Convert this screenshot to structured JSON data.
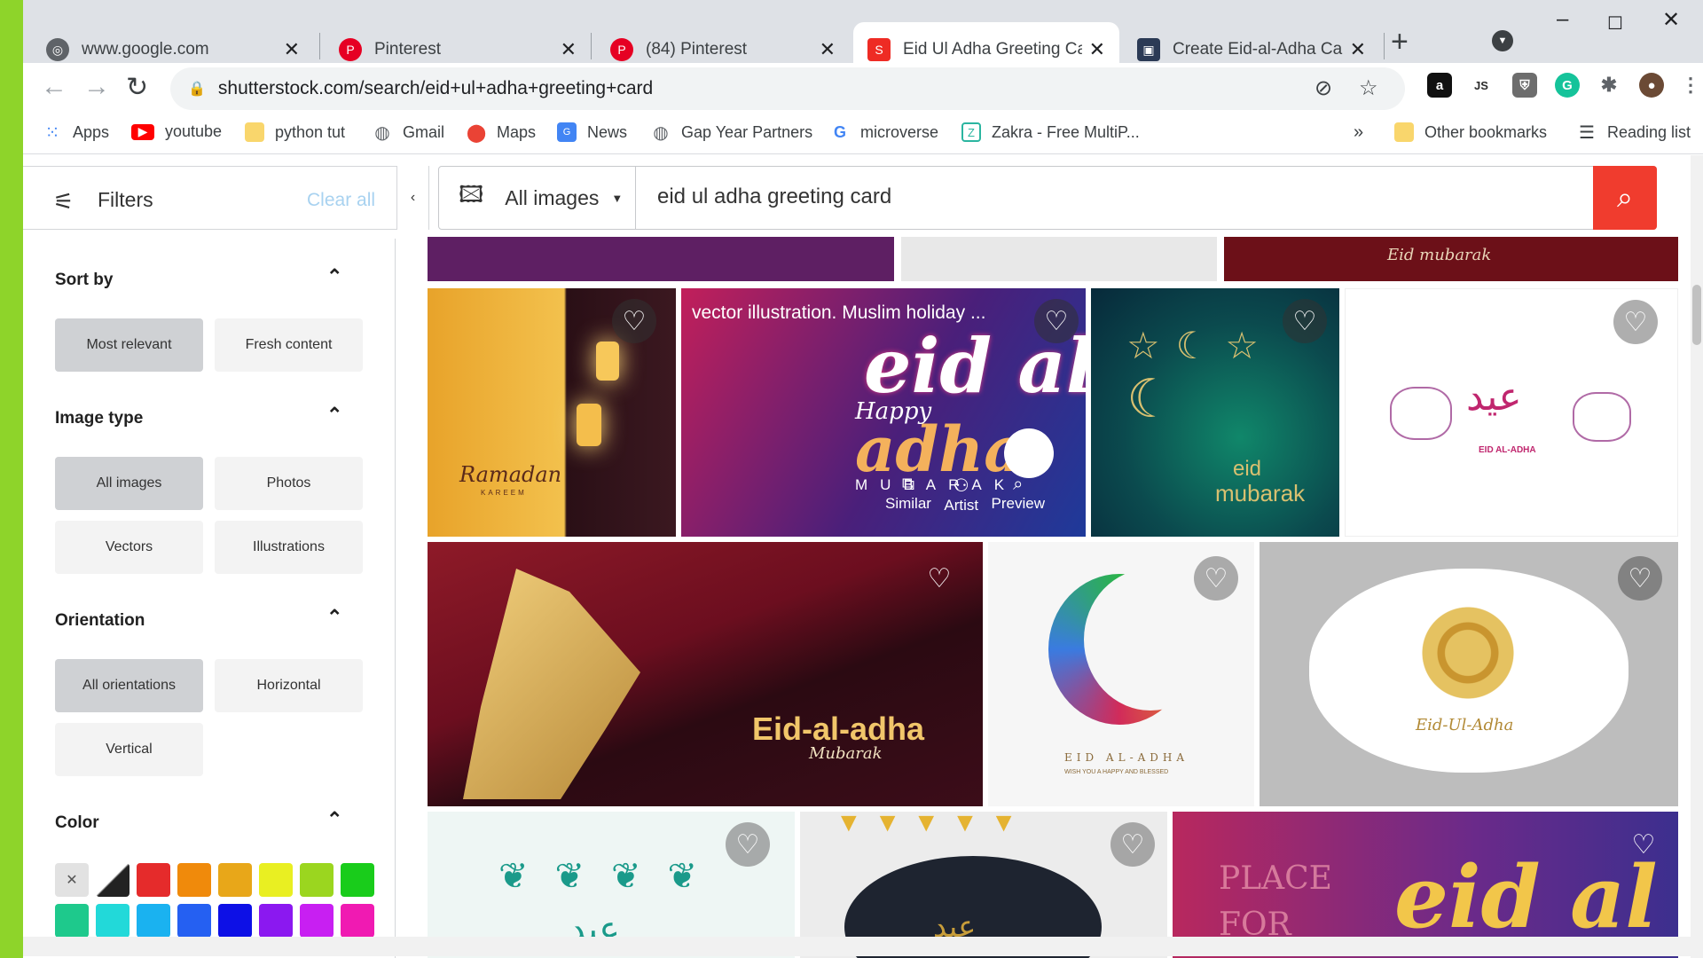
{
  "tabs": [
    {
      "title": "www.google.com",
      "icon": "globe-icon",
      "active": false
    },
    {
      "title": "Pinterest",
      "icon": "pinterest-icon",
      "active": false
    },
    {
      "title": "(84) Pinterest",
      "icon": "pinterest-icon",
      "active": false
    },
    {
      "title": "Eid Ul Adha Greeting Card",
      "icon": "shutterstock-icon",
      "active": true
    },
    {
      "title": "Create Eid-al-Adha Cards",
      "icon": "site-icon",
      "active": false
    }
  ],
  "address": {
    "url": "shutterstock.com/search/eid+ul+adha+greeting+card"
  },
  "bookmarks": [
    {
      "label": "Apps",
      "icon": "apps-grid-icon"
    },
    {
      "label": "youtube",
      "icon": "youtube-icon"
    },
    {
      "label": "python tut",
      "icon": "folder-icon"
    },
    {
      "label": "Gmail",
      "icon": "globe-icon"
    },
    {
      "label": "Maps",
      "icon": "maps-pin-icon"
    },
    {
      "label": "News",
      "icon": "news-icon"
    },
    {
      "label": "Gap Year Partners",
      "icon": "globe-icon"
    },
    {
      "label": "microverse",
      "icon": "google-icon"
    },
    {
      "label": "Zakra - Free MultiP...",
      "icon": "zakra-icon"
    }
  ],
  "bookmarks_right": {
    "more": "»",
    "other": "Other bookmarks",
    "reading": "Reading list"
  },
  "filters": {
    "title": "Filters",
    "clear": "Clear all",
    "collapse": "‹"
  },
  "sections": {
    "sort": {
      "title": "Sort by",
      "options": [
        "Most relevant",
        "Fresh content"
      ]
    },
    "image_type": {
      "title": "Image type",
      "options": [
        "All images",
        "Photos",
        "Vectors",
        "Illustrations"
      ]
    },
    "orientation": {
      "title": "Orientation",
      "options": [
        "All orientations",
        "Horizontal",
        "Vertical"
      ]
    },
    "color": {
      "title": "Color",
      "swatches": [
        "#e52b2b",
        "#f08a0b",
        "#e8a719",
        "#e9ef22",
        "#9bd61f",
        "#19cc1b",
        "#1ec98c",
        "#22d9d9",
        "#1ab2f0",
        "#2560f2",
        "#0d10e6",
        "#8b18f0",
        "#c81ff2",
        "#f01ab2"
      ]
    }
  },
  "search": {
    "type": "All images",
    "query": "eid ul adha greeting card"
  },
  "results": {
    "top_banner": "Eid mubarak",
    "hover_title": "vector illustration. Muslim holiday ...",
    "hover_actions": [
      "Similar",
      "Artist",
      "Preview"
    ],
    "card_texts": {
      "ramadan": "Ramadan",
      "ramadan_sub": "KAREEM",
      "eid_big": "eid al",
      "happy": "Happy",
      "adha": "adha",
      "mubarak_caps": "MUBARAK",
      "eid_green": "eid",
      "mubarak_green": "mubarak",
      "eid_al_adha_small": "EID AL-ADHA",
      "eid_al_adha_gold": "Eid-al-adha",
      "mubarak_script": "Mubarak",
      "eid_al_adha_spaced": "EID AL-ADHA",
      "wish": "WISH YOU A HAPPY AND BLESSED",
      "eid_ul_adha": "Eid-Ul-Adha",
      "place_for": "PLACE FOR",
      "eid_al_pink": "eid al"
    }
  }
}
